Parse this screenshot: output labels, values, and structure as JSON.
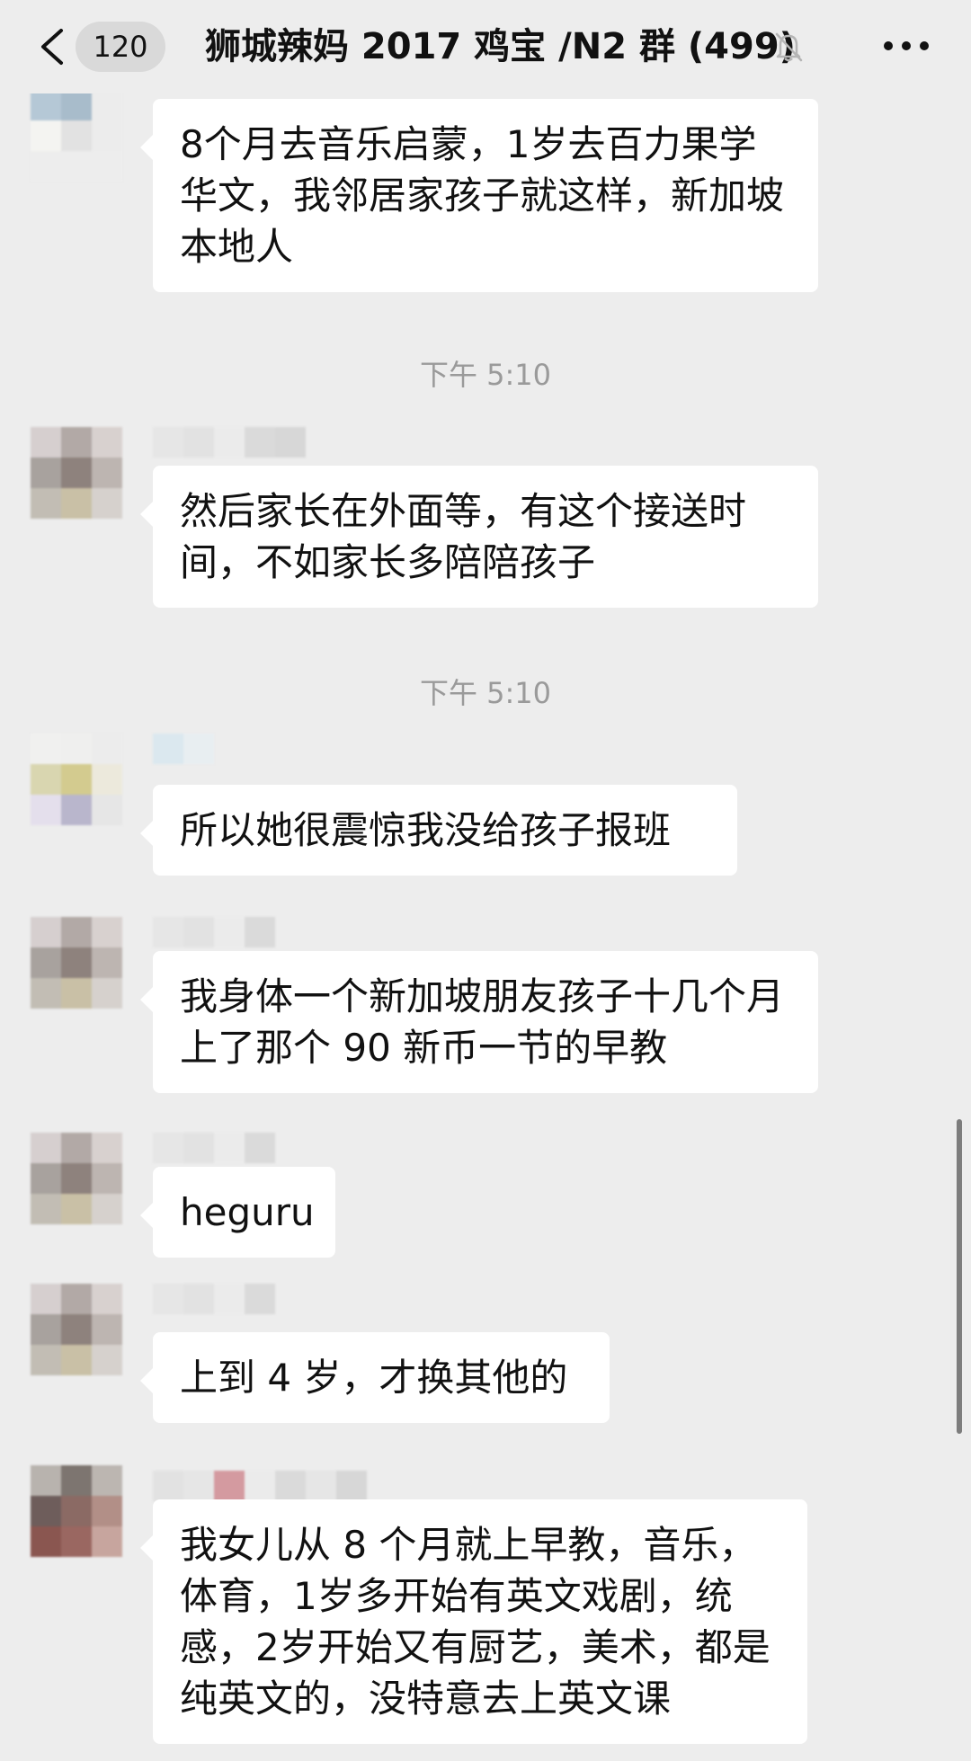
{
  "header": {
    "back_icon": "chevron-left-icon",
    "unread_count": "120",
    "title": "狮城辣妈 2017 鸡宝 /N2 群 (499)",
    "mute_icon": "muted-bell-icon",
    "more_icon": "ellipsis-icon"
  },
  "timestamps": [
    "下午 5:10",
    "下午 5:10"
  ],
  "messages": [
    {
      "text": "8个月去音乐启蒙，1岁去百力果学华文，我邻居家孩子就这样，新加坡本地人"
    },
    {
      "text": "然后家长在外面等，有这个接送时间，不如家长多陪陪孩子"
    },
    {
      "text": "所以她很震惊我没给孩子报班"
    },
    {
      "text": "我身体一个新加坡朋友孩子十几个月上了那个 90 新币一节的早教"
    },
    {
      "text": "heguru"
    },
    {
      "text": "上到 4 岁，才换其他的"
    },
    {
      "text": "我女儿从 8 个月就上早教，音乐，体育，1岁多开始有英文戏剧，统感，2岁开始又有厨艺，美术，都是纯英文的，没特意去上英文课"
    }
  ],
  "colors": {
    "background": "#ededed",
    "bubble": "#ffffff",
    "text": "#111111",
    "timestamp": "#9a9a9a",
    "badge": "#d9d9d9"
  }
}
